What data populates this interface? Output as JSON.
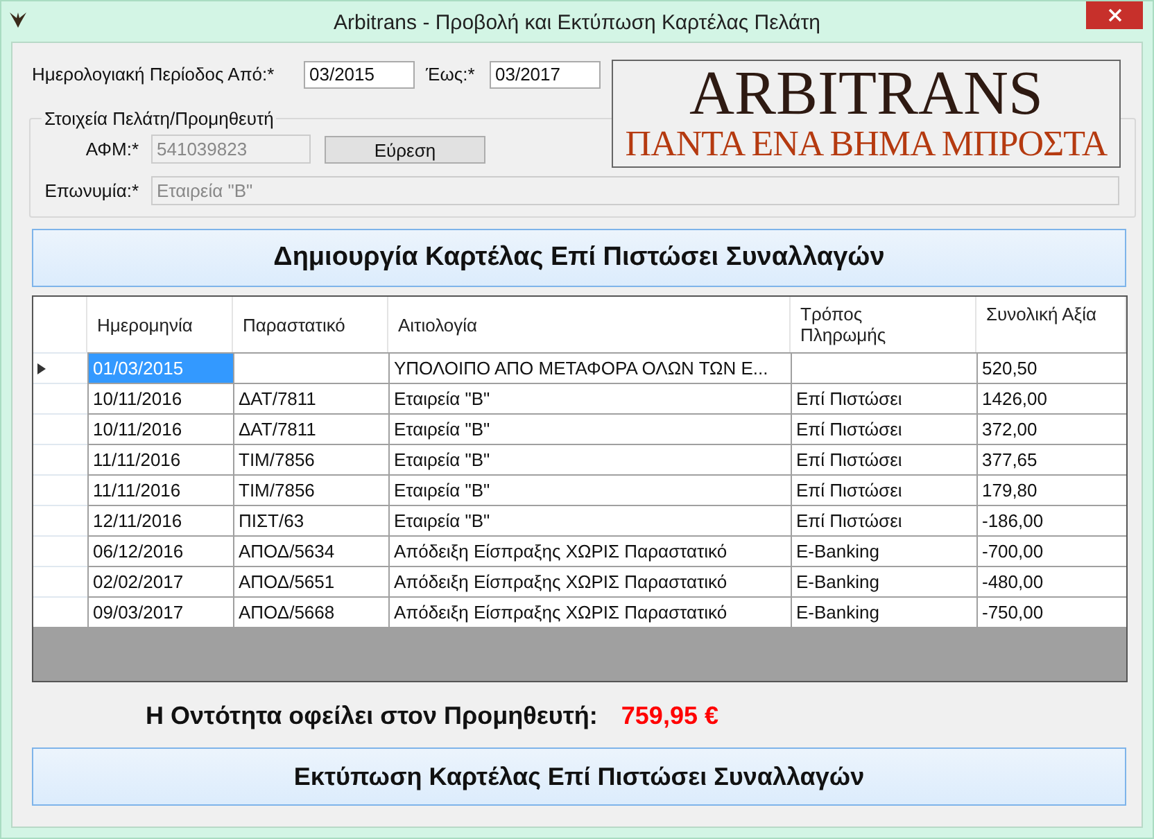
{
  "window": {
    "title": "Arbitrans - Προβολή και Εκτύπωση Καρτέλας Πελάτη"
  },
  "period": {
    "from_label": "Ημερολογιακή Περίοδος Από:*",
    "from_value": "03/2015",
    "to_label": "Έως:*",
    "to_value": "03/2017"
  },
  "logo": {
    "name": "ARBITRANS",
    "slogan": "ΠΑΝΤΑ ΕΝΑ ΒΗΜΑ ΜΠΡΟΣΤΑ"
  },
  "customer_group": {
    "title": "Στοιχεία Πελάτη/Προμηθευτή",
    "afm_label": "ΑΦΜ:*",
    "afm_value": "541039823",
    "find_button": "Εύρεση",
    "name_label": "Επωνυμία:*",
    "name_value": "Εταιρεία \"Β\""
  },
  "create_button": "Δημιουργία Καρτέλας Επί Πιστώσει Συναλλαγών",
  "table": {
    "columns": [
      "Ημερομηνία",
      "Παραστατικό",
      "Αιτιολογία",
      "Τρόπος Πληρωμής",
      "Συνολική Αξία"
    ],
    "rows": [
      {
        "selected": true,
        "cells": [
          "01/03/2015",
          "",
          "ΥΠΟΛΟΙΠΟ ΑΠΟ ΜΕΤΑΦΟΡΑ ΟΛΩΝ ΤΩΝ Ε...",
          "",
          "520,50"
        ]
      },
      {
        "selected": false,
        "cells": [
          "10/11/2016",
          "ΔΑΤ/7811",
          "Εταιρεία \"Β\"",
          "Επί Πιστώσει",
          "1426,00"
        ]
      },
      {
        "selected": false,
        "cells": [
          "10/11/2016",
          "ΔΑΤ/7811",
          "Εταιρεία \"Β\"",
          "Επί Πιστώσει",
          "372,00"
        ]
      },
      {
        "selected": false,
        "cells": [
          "11/11/2016",
          "ΤΙΜ/7856",
          "Εταιρεία \"Β\"",
          "Επί Πιστώσει",
          "377,65"
        ]
      },
      {
        "selected": false,
        "cells": [
          "11/11/2016",
          "ΤΙΜ/7856",
          "Εταιρεία \"Β\"",
          "Επί Πιστώσει",
          "179,80"
        ]
      },
      {
        "selected": false,
        "cells": [
          "12/11/2016",
          "ΠΙΣΤ/63",
          "Εταιρεία \"Β\"",
          "Επί Πιστώσει",
          "-186,00"
        ]
      },
      {
        "selected": false,
        "cells": [
          "06/12/2016",
          "ΑΠΟΔ/5634",
          "Απόδειξη Είσπραξης ΧΩΡΙΣ Παραστατικό",
          "E-Banking",
          "-700,00"
        ]
      },
      {
        "selected": false,
        "cells": [
          "02/02/2017",
          "ΑΠΟΔ/5651",
          "Απόδειξη Είσπραξης ΧΩΡΙΣ Παραστατικό",
          "E-Banking",
          "-480,00"
        ]
      },
      {
        "selected": false,
        "cells": [
          "09/03/2017",
          "ΑΠΟΔ/5668",
          "Απόδειξη Είσπραξης ΧΩΡΙΣ Παραστατικό",
          "E-Banking",
          "-750,00"
        ]
      }
    ]
  },
  "balance": {
    "label": "Η Οντότητα οφείλει στον Προμηθευτή:",
    "value": "759,95 €"
  },
  "print_button": "Εκτύπωση Καρτέλας Επί Πιστώσει Συναλλαγών"
}
